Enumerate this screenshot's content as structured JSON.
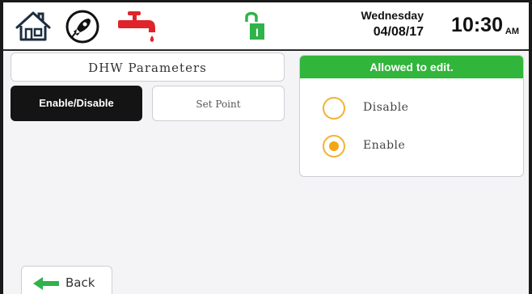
{
  "header": {
    "icons": [
      "home-icon",
      "rocket-icon",
      "faucet-icon",
      "lock-icon"
    ],
    "lock_letter": "I",
    "day": "Wednesday",
    "date": "04/08/17",
    "time": "10:30",
    "ampm": "AM"
  },
  "page": {
    "title": "DHW Parameters"
  },
  "tabs": [
    {
      "label": "Enable/Disable",
      "active": true
    },
    {
      "label": "Set Point",
      "active": false
    }
  ],
  "panel": {
    "header": "Allowed to edit.",
    "options": [
      {
        "label": "Disable",
        "selected": false
      },
      {
        "label": "Enable",
        "selected": true
      }
    ]
  },
  "footer": {
    "back_label": "Back"
  },
  "colors": {
    "accent_green": "#31b53b",
    "radio_orange": "#f3a712",
    "faucet_red": "#e0242b",
    "lock_green": "#2fb34a"
  }
}
